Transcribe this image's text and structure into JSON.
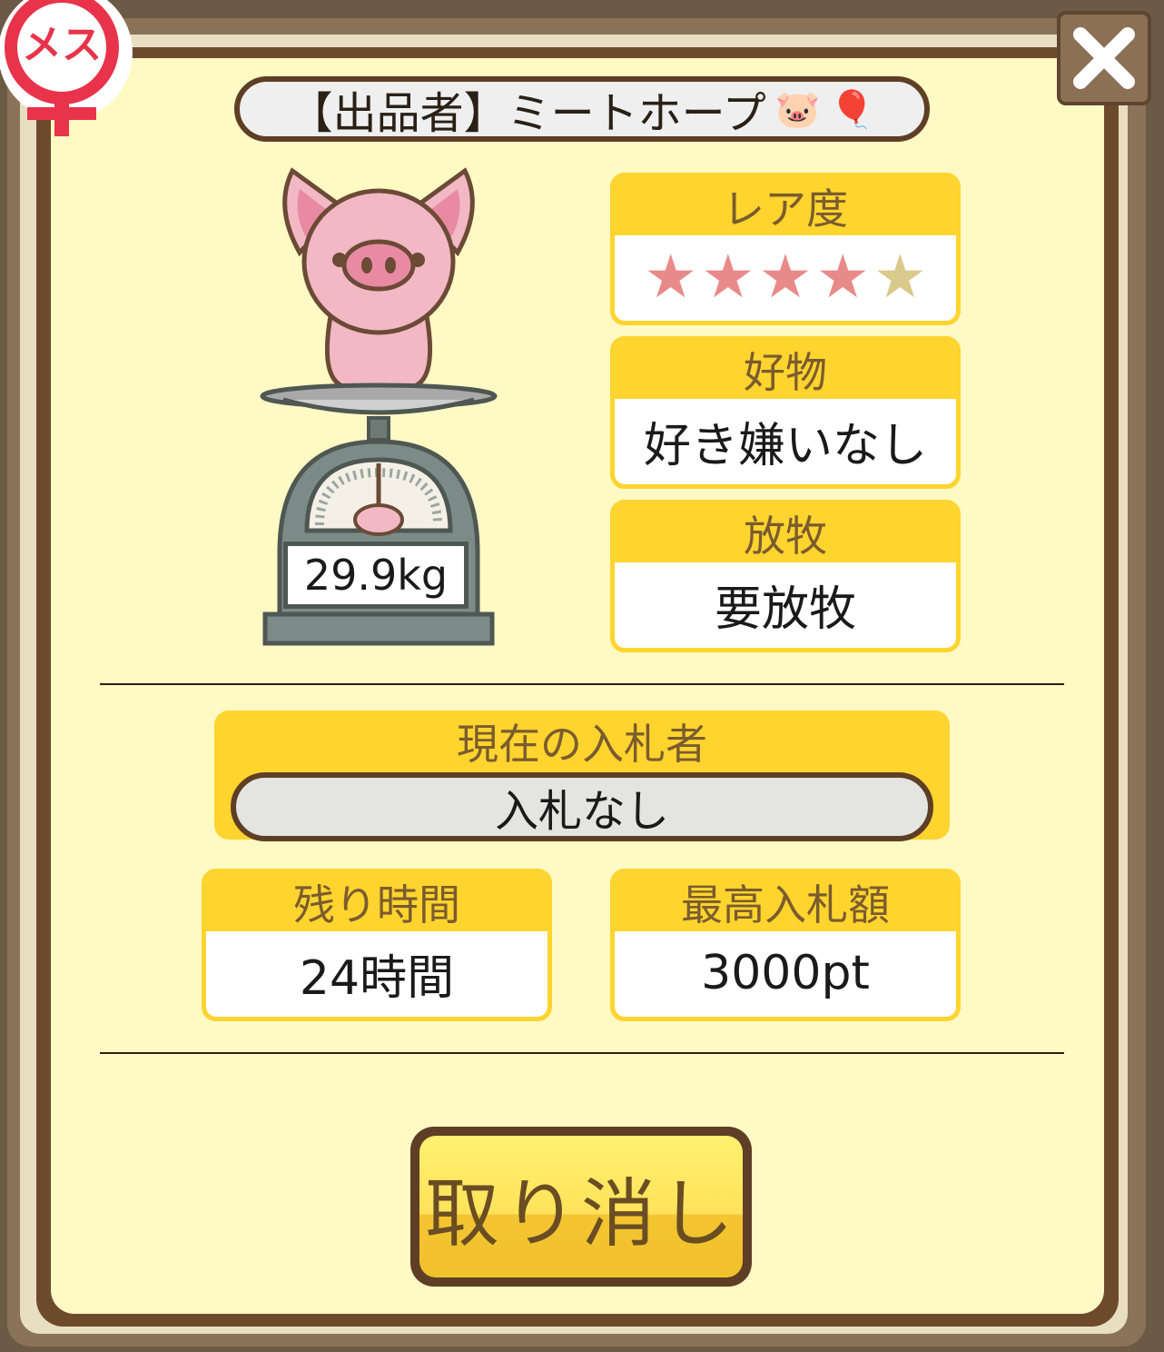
{
  "gender_badge": {
    "label": "メス",
    "icon": "female-symbol-icon",
    "color": "#e8334a"
  },
  "close_button": {
    "icon": "close-icon"
  },
  "seller": {
    "label": "【出品者】ミートホープ",
    "emoji_1": "🐷",
    "emoji_2": "🎈"
  },
  "pig": {
    "weight": "29.9kg",
    "icon": "pig-on-scale-icon"
  },
  "rarity": {
    "title": "レア度",
    "filled": 4,
    "total": 5,
    "star": "★"
  },
  "favorite": {
    "title": "好物",
    "value": "好き嫌いなし"
  },
  "grazing": {
    "title": "放牧",
    "value": "要放牧"
  },
  "current_bidder": {
    "title": "現在の入札者",
    "value": "入札なし"
  },
  "time_left": {
    "title": "残り時間",
    "value": "24時間"
  },
  "max_bid": {
    "title": "最高入札額",
    "value": "3000pt"
  },
  "cancel_button": {
    "label": "取り消し"
  },
  "colors": {
    "card_header": "#ffd42e",
    "panel": "#fff9c4",
    "frame": "#6e4a2c"
  }
}
